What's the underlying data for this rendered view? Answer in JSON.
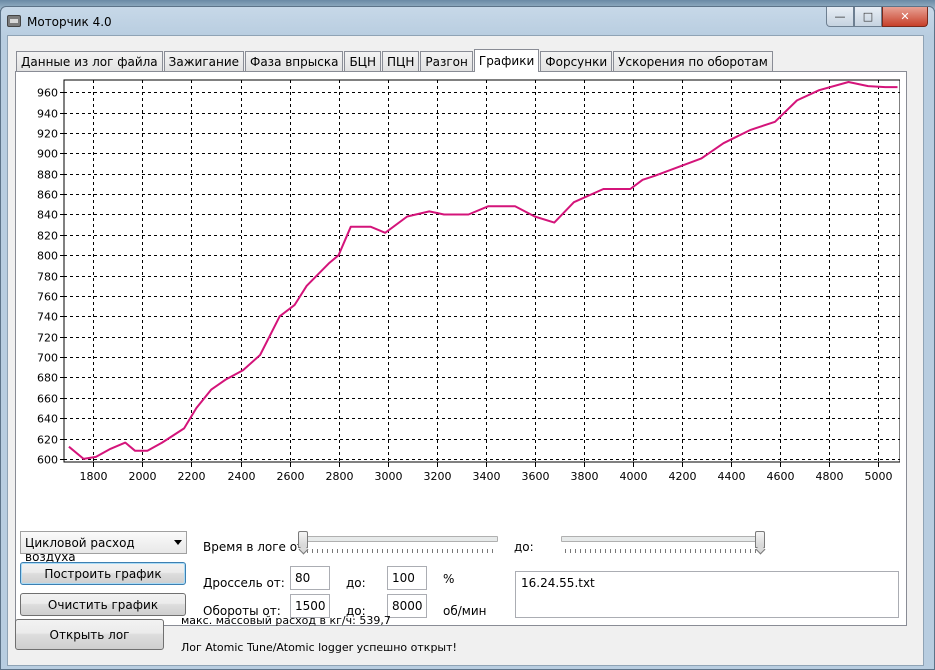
{
  "window": {
    "title": "Моторчик 4.0"
  },
  "tabs": [
    {
      "label": "Данные из лог файла",
      "active": false
    },
    {
      "label": "Зажигание",
      "active": false
    },
    {
      "label": "Фаза впрыска",
      "active": false
    },
    {
      "label": "БЦН",
      "active": false
    },
    {
      "label": "ПЦН",
      "active": false
    },
    {
      "label": "Разгон",
      "active": false
    },
    {
      "label": "Графики",
      "active": true
    },
    {
      "label": "Форсунки",
      "active": false
    },
    {
      "label": "Ускорения по оборотам",
      "active": false
    }
  ],
  "chart_data": {
    "type": "line",
    "title": "",
    "xlabel": "",
    "ylabel": "",
    "xlim": [
      1680,
      5090
    ],
    "ylim": [
      597,
      972
    ],
    "x_ticks": [
      1800,
      2000,
      2200,
      2400,
      2600,
      2800,
      3000,
      3200,
      3400,
      3600,
      3800,
      4000,
      4200,
      4400,
      4600,
      4800,
      5000
    ],
    "y_ticks": [
      600,
      620,
      640,
      660,
      680,
      700,
      720,
      740,
      760,
      780,
      800,
      820,
      840,
      860,
      880,
      900,
      920,
      940,
      960
    ],
    "grid": true,
    "line_color": "#d4147a",
    "series": [
      {
        "x": [
          1700,
          1760,
          1810,
          1870,
          1930,
          1970,
          2020,
          2080,
          2170,
          2220,
          2280,
          2340,
          2410,
          2480,
          2560,
          2620,
          2670,
          2760,
          2800,
          2850,
          2930,
          2990,
          3080,
          3170,
          3230,
          3330,
          3410,
          3520,
          3600,
          3680,
          3760,
          3880,
          3990,
          4040,
          4090,
          4180,
          4280,
          4370,
          4480,
          4580,
          4670,
          4760,
          4880,
          4960,
          5030,
          5080
        ],
        "y": [
          612,
          600,
          602,
          610,
          616,
          608,
          608,
          616,
          630,
          650,
          668,
          678,
          687,
          702,
          740,
          751,
          770,
          792,
          800,
          828,
          828,
          822,
          838,
          843,
          840,
          840,
          848,
          848,
          838,
          832,
          852,
          865,
          865,
          874,
          878,
          886,
          895,
          910,
          923,
          931,
          952,
          962,
          970,
          966,
          965,
          965
        ]
      }
    ]
  },
  "controls": {
    "param_select": "Цикловой расход воздуха",
    "build_btn": "Построить график",
    "clear_btn": "Очистить график",
    "time_label": "Время в логе от",
    "time_to_label": "до:",
    "time_from_pos": 0.0,
    "time_to_pos": 1.0,
    "throttle_label": "Дроссель от:",
    "throttle_from": "80",
    "throttle_to_label": "до:",
    "throttle_to": "100",
    "throttle_unit": "%",
    "rpm_label": "Обороты от:",
    "rpm_from": "1500",
    "rpm_to_label": "до:",
    "rpm_to": "8000",
    "rpm_unit": "об/мин",
    "file_list": "16.24.55.txt"
  },
  "footer": {
    "open_btn": "Открыть лог",
    "max_flow": "макс. массовый расход в кг/ч: 539,7",
    "status": "Лог Atomic Tune/Atomic logger успешно открыт!"
  }
}
